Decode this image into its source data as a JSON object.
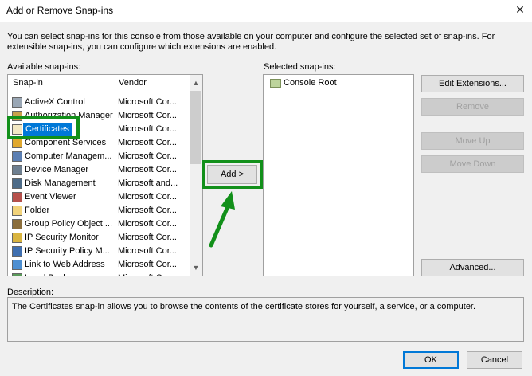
{
  "window": {
    "title": "Add or Remove Snap-ins",
    "close_glyph": "✕"
  },
  "intro": "You can select snap-ins for this console from those available on your computer and configure the selected set of snap-ins. For extensible snap-ins, you can configure which extensions are enabled.",
  "available": {
    "label": "Available snap-ins:",
    "columns": {
      "snapin": "Snap-in",
      "vendor": "Vendor"
    },
    "items": [
      {
        "name": "ActiveX Control",
        "vendor": "Microsoft Cor...",
        "icon": "activex-icon"
      },
      {
        "name": "Authorization Manager",
        "vendor": "Microsoft Cor...",
        "icon": "authorization-icon"
      },
      {
        "name": "Certificates",
        "vendor": "Microsoft Cor...",
        "icon": "certificate-icon"
      },
      {
        "name": "Component Services",
        "vendor": "Microsoft Cor...",
        "icon": "component-icon"
      },
      {
        "name": "Computer Managem...",
        "vendor": "Microsoft Cor...",
        "icon": "computer-management-icon"
      },
      {
        "name": "Device Manager",
        "vendor": "Microsoft Cor...",
        "icon": "device-manager-icon"
      },
      {
        "name": "Disk Management",
        "vendor": "Microsoft and...",
        "icon": "disk-icon"
      },
      {
        "name": "Event Viewer",
        "vendor": "Microsoft Cor...",
        "icon": "event-viewer-icon"
      },
      {
        "name": "Folder",
        "vendor": "Microsoft Cor...",
        "icon": "folder-icon"
      },
      {
        "name": "Group Policy Object ...",
        "vendor": "Microsoft Cor...",
        "icon": "policy-icon"
      },
      {
        "name": "IP Security Monitor",
        "vendor": "Microsoft Cor...",
        "icon": "security-icon"
      },
      {
        "name": "IP Security Policy M...",
        "vendor": "Microsoft Cor...",
        "icon": "security-policy-icon"
      },
      {
        "name": "Link to Web Address",
        "vendor": "Microsoft Cor...",
        "icon": "web-link-icon"
      },
      {
        "name": "Local Backup",
        "vendor": "Microsoft Cor...",
        "icon": "backup-icon"
      }
    ],
    "selected_index": 2
  },
  "add_button": "Add >",
  "selected": {
    "label": "Selected snap-ins:",
    "items": [
      {
        "name": "Console Root",
        "icon": "folder-icon"
      }
    ]
  },
  "side_buttons": {
    "edit_extensions": "Edit Extensions...",
    "remove": "Remove",
    "move_up": "Move Up",
    "move_down": "Move Down",
    "advanced": "Advanced..."
  },
  "description": {
    "label": "Description:",
    "text": "The Certificates snap-in allows you to browse the contents of the certificate stores for yourself, a service, or a computer."
  },
  "footer": {
    "ok": "OK",
    "cancel": "Cancel"
  },
  "colors": {
    "highlight_green": "#12901a",
    "selection_blue": "#0078d7"
  }
}
